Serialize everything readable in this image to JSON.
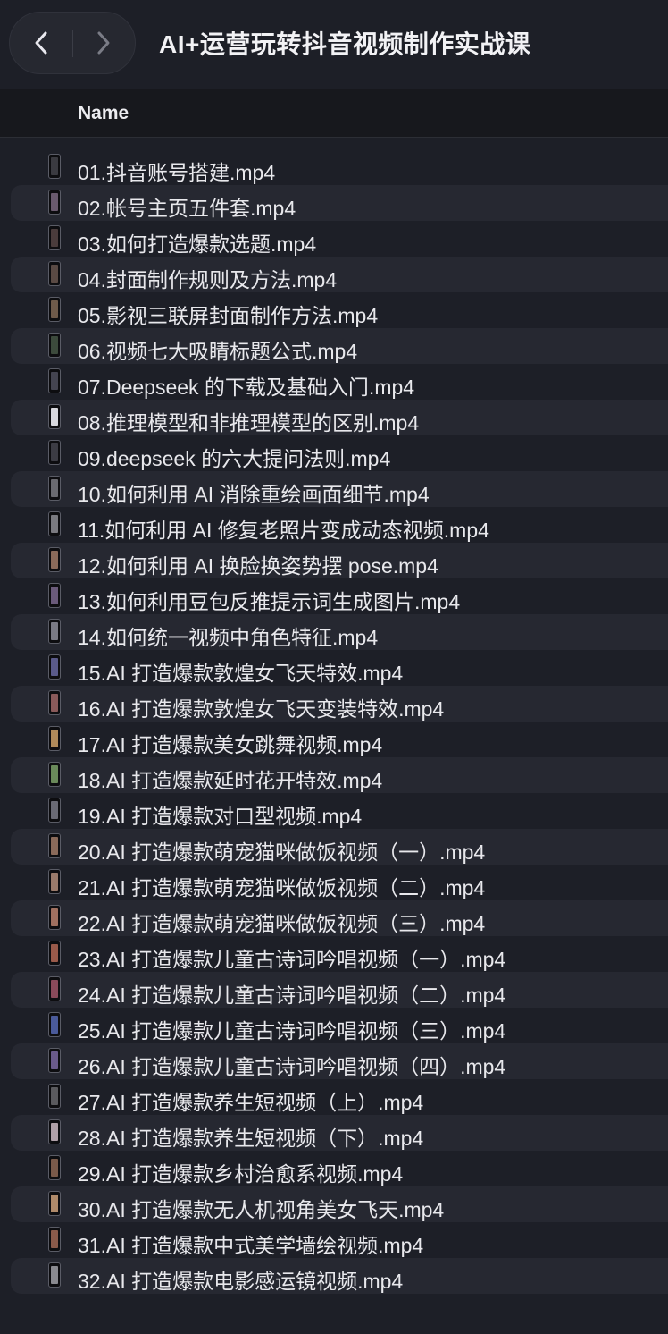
{
  "window": {
    "title": "AI+运营玩转抖音视频制作实战课",
    "back_icon": "chevron-left-icon",
    "forward_icon": "chevron-right-icon"
  },
  "header": {
    "name_label": "Name"
  },
  "files": [
    {
      "name": "01.抖音账号搭建.mp4",
      "thumb": "#3a3a40"
    },
    {
      "name": "02.帐号主页五件套.mp4",
      "thumb": "#6a5a6e"
    },
    {
      "name": "03.如何打造爆款选题.mp4",
      "thumb": "#4a3c3c"
    },
    {
      "name": "04.封面制作规则及方法.mp4",
      "thumb": "#5a4a44"
    },
    {
      "name": "05.影视三联屏封面制作方法.mp4",
      "thumb": "#6e5a4a"
    },
    {
      "name": "06.视频七大吸睛标题公式.mp4",
      "thumb": "#3c4a3c"
    },
    {
      "name": "07.Deepseek 的下载及基础入门.mp4",
      "thumb": "#444450"
    },
    {
      "name": "08.推理模型和非推理模型的区别.mp4",
      "thumb": "#d8d8de"
    },
    {
      "name": "09.deepseek 的六大提问法则.mp4",
      "thumb": "#3c3c44"
    },
    {
      "name": "10.如何利用 AI 消除重绘画面细节.mp4",
      "thumb": "#6a6a70"
    },
    {
      "name": "11.如何利用 AI 修复老照片变成动态视频.mp4",
      "thumb": "#7a7a80"
    },
    {
      "name": "12.如何利用 AI 换脸换姿势摆 pose.mp4",
      "thumb": "#8a6a5a"
    },
    {
      "name": "13.如何利用豆包反推提示词生成图片.mp4",
      "thumb": "#6a5a7a"
    },
    {
      "name": "14.如何统一视频中角色特征.mp4",
      "thumb": "#7a7a84"
    },
    {
      "name": "15.AI 打造爆款敦煌女飞天特效.mp4",
      "thumb": "#5a5a8a"
    },
    {
      "name": "16.AI 打造爆款敦煌女飞天变装特效.mp4",
      "thumb": "#8a5a5a"
    },
    {
      "name": "17.AI 打造爆款美女跳舞视频.mp4",
      "thumb": "#b08a5a"
    },
    {
      "name": "18.AI 打造爆款延时花开特效.mp4",
      "thumb": "#6a8a5a"
    },
    {
      "name": "19.AI 打造爆款对口型视频.mp4",
      "thumb": "#6a6a74"
    },
    {
      "name": "20.AI 打造爆款萌宠猫咪做饭视频（一）.mp4",
      "thumb": "#8a6a5a"
    },
    {
      "name": "21.AI 打造爆款萌宠猫咪做饭视频（二）.mp4",
      "thumb": "#9a7a6a"
    },
    {
      "name": "22.AI 打造爆款萌宠猫咪做饭视频（三）.mp4",
      "thumb": "#a07060"
    },
    {
      "name": "23.AI 打造爆款儿童古诗词吟唱视频（一）.mp4",
      "thumb": "#9a5a4a"
    },
    {
      "name": "24.AI 打造爆款儿童古诗词吟唱视频（二）.mp4",
      "thumb": "#8a4a5a"
    },
    {
      "name": "25.AI 打造爆款儿童古诗词吟唱视频（三）.mp4",
      "thumb": "#4a5a9a"
    },
    {
      "name": "26.AI 打造爆款儿童古诗词吟唱视频（四）.mp4",
      "thumb": "#6a5a8a"
    },
    {
      "name": "27.AI 打造爆款养生短视频（上）.mp4",
      "thumb": "#5a5a5e"
    },
    {
      "name": "28.AI 打造爆款养生短视频（下）.mp4",
      "thumb": "#b0a0a8"
    },
    {
      "name": "29.AI 打造爆款乡村治愈系视频.mp4",
      "thumb": "#7a5a4a"
    },
    {
      "name": "30.AI 打造爆款无人机视角美女飞天.mp4",
      "thumb": "#b08a6a"
    },
    {
      "name": "31.AI 打造爆款中式美学墙绘视频.mp4",
      "thumb": "#8a5a4a"
    },
    {
      "name": "32.AI 打造爆款电影感运镜视频.mp4",
      "thumb": "#8a8a90"
    }
  ]
}
